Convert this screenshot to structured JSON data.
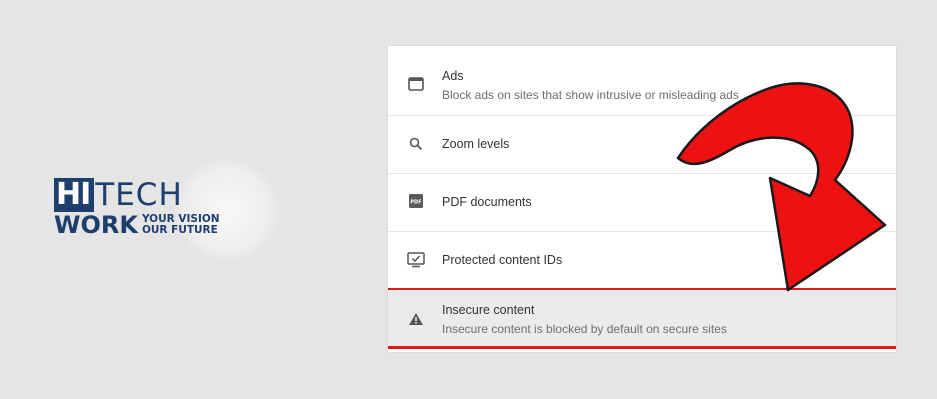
{
  "logo": {
    "hi": "HI",
    "tech": "TECH",
    "work": "WORK",
    "tagline_line1": "YOUR VISION",
    "tagline_line2": "OUR FUTURE",
    "color": "#1d3f6e"
  },
  "settings": {
    "rows": [
      {
        "icon": "window-icon",
        "title": "Ads",
        "subtitle": "Block ads on sites that show intrusive or misleading ads"
      },
      {
        "icon": "search-icon",
        "title": "Zoom levels"
      },
      {
        "icon": "pdf-icon",
        "title": "PDF documents",
        "icon_text": "PDF"
      },
      {
        "icon": "monitor-check-icon",
        "title": "Protected content IDs"
      },
      {
        "icon": "warning-icon",
        "title": "Insecure content",
        "subtitle": "Insecure content is blocked by default on secure sites",
        "highlighted": true
      }
    ]
  },
  "annotation": {
    "arrow_color": "#ee1111",
    "highlight_color": "#e01b1b"
  }
}
